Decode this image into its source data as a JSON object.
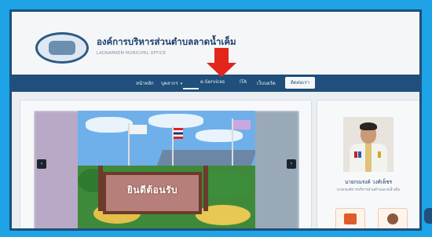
{
  "header": {
    "site_title": "องค์การบริหารส่วนตำบลลาดน้ำเค็ม",
    "site_subtitle": "LADNAMKEM MUNICIPAL OFFICE"
  },
  "nav": {
    "items": [
      {
        "label": "หน้าหลัก"
      },
      {
        "label": "บุคลากร",
        "has_dropdown": true
      },
      {
        "label": "e-Services"
      },
      {
        "label": "ITA"
      },
      {
        "label": "เว็บบอร์ด"
      }
    ],
    "contact_button": "ติดต่อเรา"
  },
  "slider": {
    "sign_text": "ยินดีต้อนรับ",
    "prev_icon": "‹",
    "next_icon": "›"
  },
  "profile": {
    "name": "นายกณรงค์ วงศ์เพ็ชร",
    "title": "นายกองค์การบริหารส่วนตำบลลาดน้ำเค็ม"
  },
  "colors": {
    "nav_bg": "#1f4f7a",
    "outer_bg": "#1ea3e6",
    "arrow": "#e2261c"
  }
}
